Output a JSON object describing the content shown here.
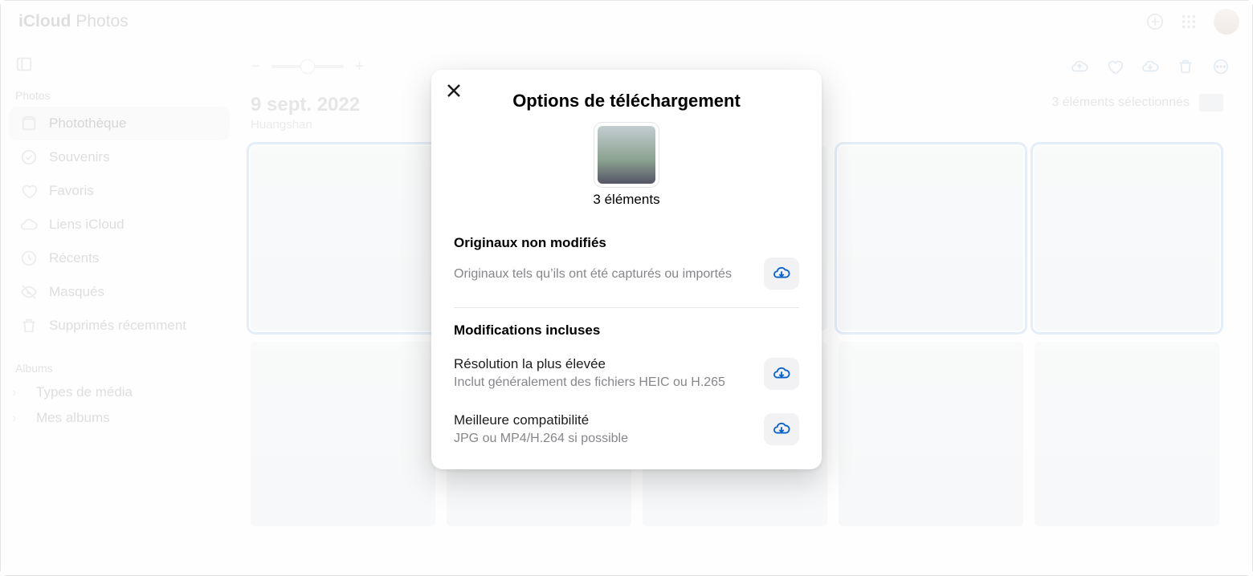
{
  "brand": {
    "icloud": "iCloud",
    "photos": "Photos"
  },
  "sidebar": {
    "section_photos": "Photos",
    "section_albums": "Albums",
    "items": [
      {
        "label": "Photothèque"
      },
      {
        "label": "Souvenirs"
      },
      {
        "label": "Favoris"
      },
      {
        "label": "Liens iCloud"
      },
      {
        "label": "Récents"
      },
      {
        "label": "Masqués"
      },
      {
        "label": "Supprimés récemment"
      }
    ],
    "albums": [
      {
        "label": "Types de média"
      },
      {
        "label": "Mes albums"
      }
    ]
  },
  "main": {
    "date": "9 sept. 2022",
    "location": "Huangshan",
    "selection_text": "3 éléments sélectionnés"
  },
  "modal": {
    "title": "Options de téléchargement",
    "count": "3 éléments",
    "section1_title": "Originaux non modifiés",
    "section1_desc": "Originaux tels qu’ils ont été capturés ou importés",
    "section2_title": "Modifications incluses",
    "opt2a_title": "Résolution la plus élevée",
    "opt2a_desc": "Inclut généralement des fichiers HEIC ou H.265",
    "opt2b_title": "Meilleure compatibilité",
    "opt2b_desc": "JPG ou MP4/H.264 si possible"
  },
  "colors": {
    "accent": "#0a62c9",
    "selection": "#9ec1e8"
  }
}
